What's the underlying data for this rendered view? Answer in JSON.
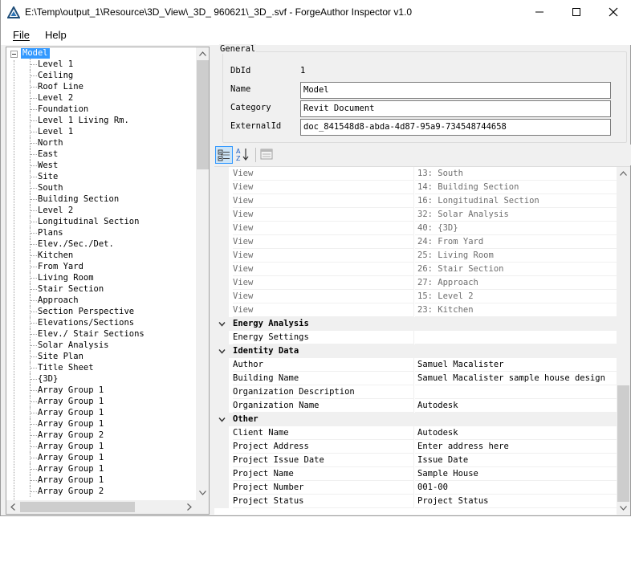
{
  "window": {
    "title": "E:\\Temp\\output_1\\Resource\\3D_View\\_3D_ 960621\\_3D_.svf - ForgeAuthor Inspector v1.0"
  },
  "menu": {
    "file": "File",
    "help": "Help"
  },
  "tree": {
    "root": "Model",
    "items": [
      "Level 1",
      "Ceiling",
      "Roof Line",
      "Level 2",
      "Foundation",
      "Level 1 Living Rm.",
      "Level 1",
      "North",
      "East",
      "West",
      "Site",
      "South",
      "Building Section",
      "Level 2",
      "Longitudinal Section",
      "Plans",
      "Elev./Sec./Det.",
      "Kitchen",
      "From Yard",
      "Living Room",
      "Stair Section",
      "Approach",
      "Section Perspective",
      "Elevations/Sections",
      "Elev./ Stair Sections",
      "Solar Analysis",
      "Site Plan",
      "Title Sheet",
      "{3D}",
      "Array Group 1",
      "Array Group 1",
      "Array Group 1",
      "Array Group 1",
      "Array Group 2",
      "Array Group 1",
      "Array Group 1",
      "Array Group 1",
      "Array Group 1",
      "Array Group 2"
    ]
  },
  "general": {
    "caption": "General",
    "dbid_label": "DbId",
    "dbid_value": "1",
    "name_label": "Name",
    "name_value": "Model",
    "category_label": "Category",
    "category_value": "Revit Document",
    "externalid_label": "ExternalId",
    "externalid_value": "doc_841548d8-abda-4d87-95a9-734548744658"
  },
  "properties": {
    "views": [
      {
        "name": "View",
        "value": "13: South"
      },
      {
        "name": "View",
        "value": "14: Building Section"
      },
      {
        "name": "View",
        "value": "16: Longitudinal Section"
      },
      {
        "name": "View",
        "value": "32: Solar Analysis"
      },
      {
        "name": "View",
        "value": "40: {3D}"
      },
      {
        "name": "View",
        "value": "24: From Yard"
      },
      {
        "name": "View",
        "value": "25: Living Room"
      },
      {
        "name": "View",
        "value": "26: Stair Section"
      },
      {
        "name": "View",
        "value": "27: Approach"
      },
      {
        "name": "View",
        "value": "15: Level 2"
      },
      {
        "name": "View",
        "value": "23: Kitchen"
      }
    ],
    "energy": {
      "label": "Energy Analysis",
      "rows": [
        {
          "name": "Energy Settings",
          "value": ""
        }
      ]
    },
    "identity": {
      "label": "Identity Data",
      "rows": [
        {
          "name": "Author",
          "value": "Samuel Macalister"
        },
        {
          "name": "Building Name",
          "value": "Samuel Macalister sample house design"
        },
        {
          "name": "Organization Description",
          "value": ""
        },
        {
          "name": "Organization Name",
          "value": "Autodesk"
        }
      ]
    },
    "other": {
      "label": "Other",
      "rows": [
        {
          "name": "Client Name",
          "value": "Autodesk"
        },
        {
          "name": "Project Address",
          "value": "Enter address here"
        },
        {
          "name": "Project Issue Date",
          "value": "Issue Date"
        },
        {
          "name": "Project Name",
          "value": "Sample House"
        },
        {
          "name": "Project Number",
          "value": "001-00"
        },
        {
          "name": "Project Status",
          "value": "Project Status"
        }
      ]
    }
  }
}
